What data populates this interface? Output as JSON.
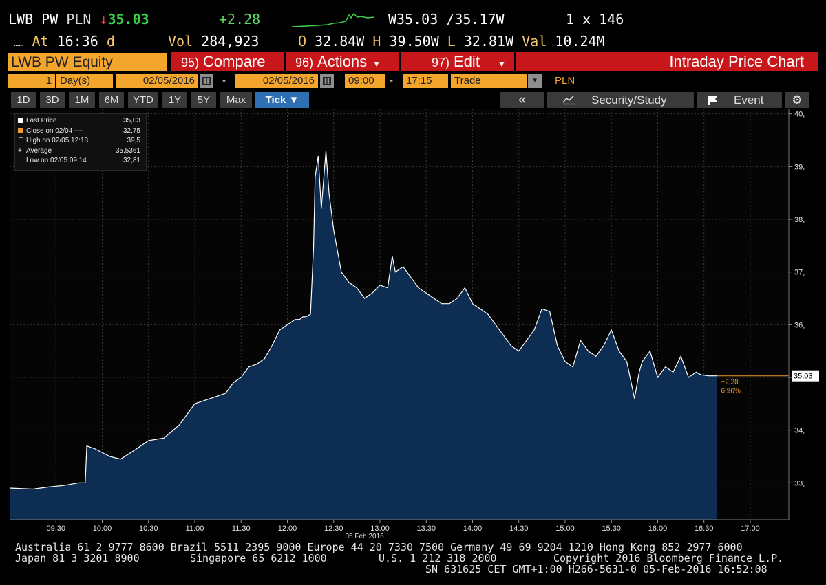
{
  "quote": {
    "ticker": "LWB PW",
    "currency": "PLN",
    "direction_arrow": "↓",
    "last": "35.03",
    "change": "+2.28",
    "bid_ask": "W35.03 /35.17W",
    "size": "1 x 146",
    "dots": "……",
    "at_label": "At",
    "at_time": "16:36",
    "at_flag": "d",
    "vol_label": "Vol",
    "volume": "284,923",
    "open_label": "O",
    "open": "32.84W",
    "high_label": "H",
    "high": "39.50W",
    "low_label": "L",
    "low": "32.81W",
    "val_label": "Val",
    "value": "10.24M"
  },
  "toolbar": {
    "security": "LWB PW Equity",
    "compare_num": "95)",
    "compare_label": "Compare",
    "actions_num": "96)",
    "actions_label": "Actions",
    "edit_num": "97)",
    "edit_label": "Edit",
    "title": "Intraday Price Chart"
  },
  "params": {
    "period_count": "1",
    "period_unit": "Day(s)",
    "start_date": "02/05/2016",
    "end_date": "02/05/2016",
    "start_time": "09:00",
    "end_time": "17:15",
    "event_type": "Trade",
    "currency": "PLN",
    "dash": "-"
  },
  "ranges": [
    "1D",
    "3D",
    "1M",
    "6M",
    "YTD",
    "1Y",
    "5Y",
    "Max"
  ],
  "range_selected": "Tick ▼",
  "tools": {
    "back": "«",
    "security_study": "Security/Study",
    "event": "Event"
  },
  "legend": {
    "items": [
      {
        "label": "Last Price",
        "value": "35,03",
        "color": "#ffffff"
      },
      {
        "label": "Close on 02/04 ----",
        "value": "32,75",
        "color": "#f39c2c"
      },
      {
        "label": "High on 02/05 12:18",
        "value": "39,5",
        "color": "#dddddd"
      },
      {
        "label": "Average",
        "value": "35,5361",
        "color": "#dddddd"
      },
      {
        "label": "Low on 02/05 09:14",
        "value": "32,81",
        "color": "#dddddd"
      }
    ]
  },
  "chart_data": {
    "type": "area",
    "x": [
      "09:05",
      "09:15",
      "09:25",
      "09:35",
      "09:45",
      "09:49",
      "09:50",
      "09:55",
      "10:05",
      "10:12",
      "10:20",
      "10:30",
      "10:40",
      "10:50",
      "11:00",
      "11:10",
      "11:20",
      "11:25",
      "11:30",
      "11:35",
      "11:40",
      "11:45",
      "11:50",
      "11:55",
      "12:05",
      "12:08",
      "12:10",
      "12:12",
      "12:15",
      "12:17",
      "12:18",
      "12:20",
      "12:22",
      "12:25",
      "12:27",
      "12:30",
      "12:35",
      "12:40",
      "12:45",
      "12:50",
      "12:55",
      "13:00",
      "13:05",
      "13:08",
      "13:10",
      "13:15",
      "13:20",
      "13:25",
      "13:30",
      "13:35",
      "13:40",
      "13:45",
      "13:50",
      "13:55",
      "14:00",
      "14:05",
      "14:10",
      "14:15",
      "14:20",
      "14:25",
      "14:30",
      "14:35",
      "14:40",
      "14:45",
      "14:50",
      "14:55",
      "15:00",
      "15:05",
      "15:10",
      "15:15",
      "15:20",
      "15:25",
      "15:30",
      "15:35",
      "15:40",
      "15:45",
      "15:48",
      "15:50",
      "15:55",
      "16:00",
      "16:05",
      "16:10",
      "16:15",
      "16:20",
      "16:25",
      "16:28",
      "16:33"
    ],
    "values": [
      32.9,
      32.88,
      32.92,
      32.95,
      33.0,
      33.0,
      33.7,
      33.65,
      33.5,
      33.45,
      33.6,
      33.8,
      33.85,
      34.1,
      34.5,
      34.6,
      34.7,
      34.9,
      35.0,
      35.2,
      35.25,
      35.35,
      35.6,
      35.9,
      36.1,
      36.1,
      36.15,
      36.15,
      36.2,
      37.5,
      38.8,
      39.2,
      38.2,
      39.3,
      38.5,
      37.8,
      37.0,
      36.8,
      36.7,
      36.5,
      36.6,
      36.75,
      36.7,
      37.3,
      37.0,
      37.1,
      36.9,
      36.7,
      36.6,
      36.5,
      36.4,
      36.4,
      36.5,
      36.7,
      36.4,
      36.3,
      36.2,
      36.0,
      35.8,
      35.6,
      35.5,
      35.7,
      35.9,
      36.3,
      36.25,
      35.6,
      35.3,
      35.2,
      35.7,
      35.5,
      35.4,
      35.6,
      35.9,
      35.5,
      35.3,
      34.6,
      35.1,
      35.3,
      35.5,
      35.0,
      35.2,
      35.1,
      35.4,
      35.0,
      35.1,
      35.05,
      35.03
    ],
    "ylim": [
      32.3,
      40.1
    ],
    "yticks": [
      33,
      34,
      35,
      36,
      37,
      38,
      39,
      40
    ],
    "xticks": [
      "09:30",
      "10:00",
      "10:30",
      "11:00",
      "11:30",
      "12:00",
      "12:30",
      "13:00",
      "13:30",
      "14:00",
      "14:30",
      "15:00",
      "15:30",
      "16:00",
      "16:30",
      "17:00"
    ],
    "xlabel": "05 Feb 2016",
    "prev_close": 32.75,
    "last_price": 35.03,
    "last_label": "35,03",
    "change_label": "+2,28",
    "change_pct_label": "6.96%",
    "fill_color": "#0d2d52",
    "line_color": "#ffffff",
    "ref_color": "#f39c2c",
    "grid": true
  },
  "footer": {
    "line1": "Australia 61 2 9777 8600 Brazil 5511 2395 9000 Europe 44 20 7330 7500 Germany 49 69 9204 1210 Hong Kong 852 2977 6000",
    "line2_left": "Japan 81 3 3201 8900",
    "line2_mid": "Singapore 65 6212 1000",
    "line2_us": "U.S. 1 212 318 2000",
    "line2_copy": "Copyright 2016 Bloomberg Finance L.P.",
    "line3": "SN 631625 CET  GMT+1:00 H266-5631-0 05-Feb-2016 16:52:08"
  }
}
